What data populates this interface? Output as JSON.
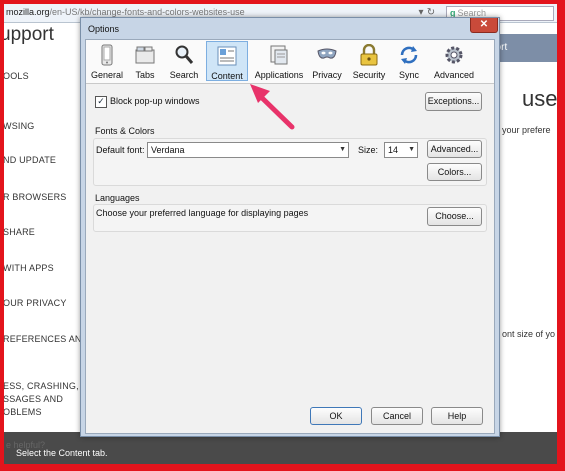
{
  "browser": {
    "url_host": "mozilla.org",
    "url_path": "/en-US/kb/change-fonts-and-colors-websites-use",
    "search_placeholder": "Search",
    "site_title": "upport",
    "right_banner": "port",
    "sidebar": [
      "OOLS",
      "WSING",
      "ND UPDATE",
      "R BROWSERS",
      "SHARE",
      "WITH APPS",
      "OUR PRIVACY",
      "REFERENCES AND",
      "ESS, CRASHING,",
      "SSAGES AND",
      "OBLEMS"
    ],
    "right_heading": "use",
    "right_text_1": "your prefere",
    "right_text_2": "ont size of yo",
    "helpful": "e helpful?"
  },
  "dialog": {
    "title": "Options",
    "close_label": "✕",
    "tabs": [
      {
        "label": "General",
        "icon": "general-icon"
      },
      {
        "label": "Tabs",
        "icon": "tabs-icon"
      },
      {
        "label": "Search",
        "icon": "search-icon"
      },
      {
        "label": "Content",
        "icon": "content-icon"
      },
      {
        "label": "Applications",
        "icon": "applications-icon"
      },
      {
        "label": "Privacy",
        "icon": "privacy-icon"
      },
      {
        "label": "Security",
        "icon": "security-icon"
      },
      {
        "label": "Sync",
        "icon": "sync-icon"
      },
      {
        "label": "Advanced",
        "icon": "advanced-icon"
      }
    ],
    "selected_tab": "Content",
    "block_popups_label": "Block pop-up windows",
    "block_popups_checked": true,
    "exceptions_button": "Exceptions...",
    "fonts_group_title": "Fonts & Colors",
    "default_font_label": "Default font:",
    "default_font_value": "Verdana",
    "size_label": "Size:",
    "size_value": "14",
    "advanced_button": "Advanced...",
    "colors_button": "Colors...",
    "languages_group_title": "Languages",
    "languages_text": "Choose your preferred language for displaying pages",
    "choose_button": "Choose...",
    "ok_button": "OK",
    "cancel_button": "Cancel",
    "help_button": "Help"
  },
  "caption": "Select the Content tab.",
  "colors": {
    "frame": "#e3141c",
    "arrow": "#e8336a",
    "selected_tab": "#cfe5f7"
  }
}
